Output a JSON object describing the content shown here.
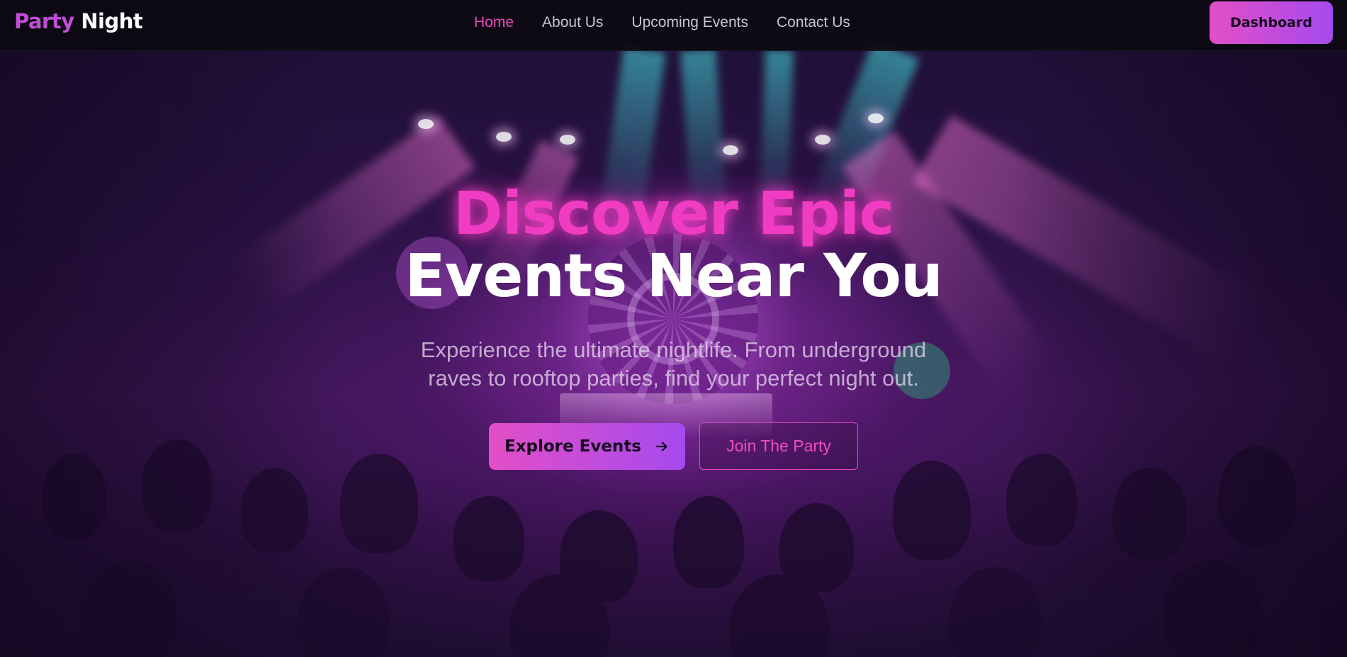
{
  "brand": {
    "part1": "Party",
    "part2": "Night"
  },
  "nav": {
    "links": [
      {
        "label": "Home",
        "active": true
      },
      {
        "label": "About Us",
        "active": false
      },
      {
        "label": "Upcoming Events",
        "active": false
      },
      {
        "label": "Contact Us",
        "active": false
      }
    ],
    "dashboard_label": "Dashboard"
  },
  "hero": {
    "title_line1": "Discover Epic",
    "title_line2": "Events Near You",
    "subtitle_line1": "Experience the ultimate nightlife. From underground",
    "subtitle_line2": "raves to rooftop parties, find your perfect night out.",
    "primary_cta": "Explore Events",
    "primary_cta_icon": "arrow-right-icon",
    "secondary_cta": "Join The Party"
  },
  "colors": {
    "accent_pink": "#e64ab8",
    "gradient_start": "#e24fc6",
    "gradient_end": "#a64aee",
    "nav_bg": "#0c0a12"
  }
}
